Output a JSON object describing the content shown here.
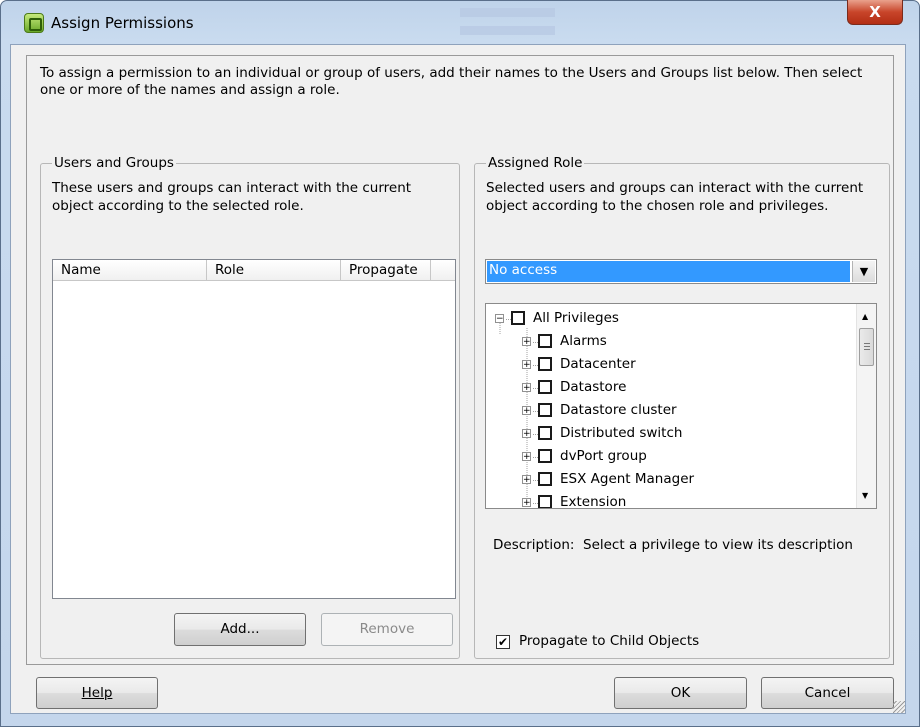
{
  "window": {
    "title": "Assign Permissions",
    "close_glyph": "X",
    "icon": "vsphere-app-icon"
  },
  "intro_text": "To assign a permission to an individual or group of users, add their names to the Users and Groups list below. Then select one or more of the names and assign a role.",
  "users_and_groups": {
    "legend": "Users and Groups",
    "description": "These users and groups can interact with the current object according to the selected role.",
    "columns": [
      "Name",
      "Role",
      "Propagate"
    ],
    "rows": [],
    "add_label": "Add...",
    "remove_label": "Remove"
  },
  "assigned_role": {
    "legend": "Assigned Role",
    "description": "Selected users and groups can interact with the current object according to the chosen role and privileges.",
    "selected_role": "No access",
    "privileges": [
      {
        "label": "All Privileges",
        "level": 0,
        "expander": "−",
        "checked": false
      },
      {
        "label": "Alarms",
        "level": 1,
        "expander": "+",
        "checked": false
      },
      {
        "label": "Datacenter",
        "level": 1,
        "expander": "+",
        "checked": false
      },
      {
        "label": "Datastore",
        "level": 1,
        "expander": "+",
        "checked": false
      },
      {
        "label": "Datastore cluster",
        "level": 1,
        "expander": "+",
        "checked": false
      },
      {
        "label": "Distributed switch",
        "level": 1,
        "expander": "+",
        "checked": false
      },
      {
        "label": "dvPort group",
        "level": 1,
        "expander": "+",
        "checked": false
      },
      {
        "label": "ESX Agent Manager",
        "level": 1,
        "expander": "+",
        "checked": false
      },
      {
        "label": "Extension",
        "level": 1,
        "expander": "+",
        "checked": false
      }
    ],
    "description_label": "Description:",
    "description_text": "Select a privilege to view its description",
    "propagate_label": "Propagate to Child Objects",
    "propagate_checked": true
  },
  "footer": {
    "help_label": "Help",
    "ok_label": "OK",
    "cancel_label": "Cancel"
  }
}
